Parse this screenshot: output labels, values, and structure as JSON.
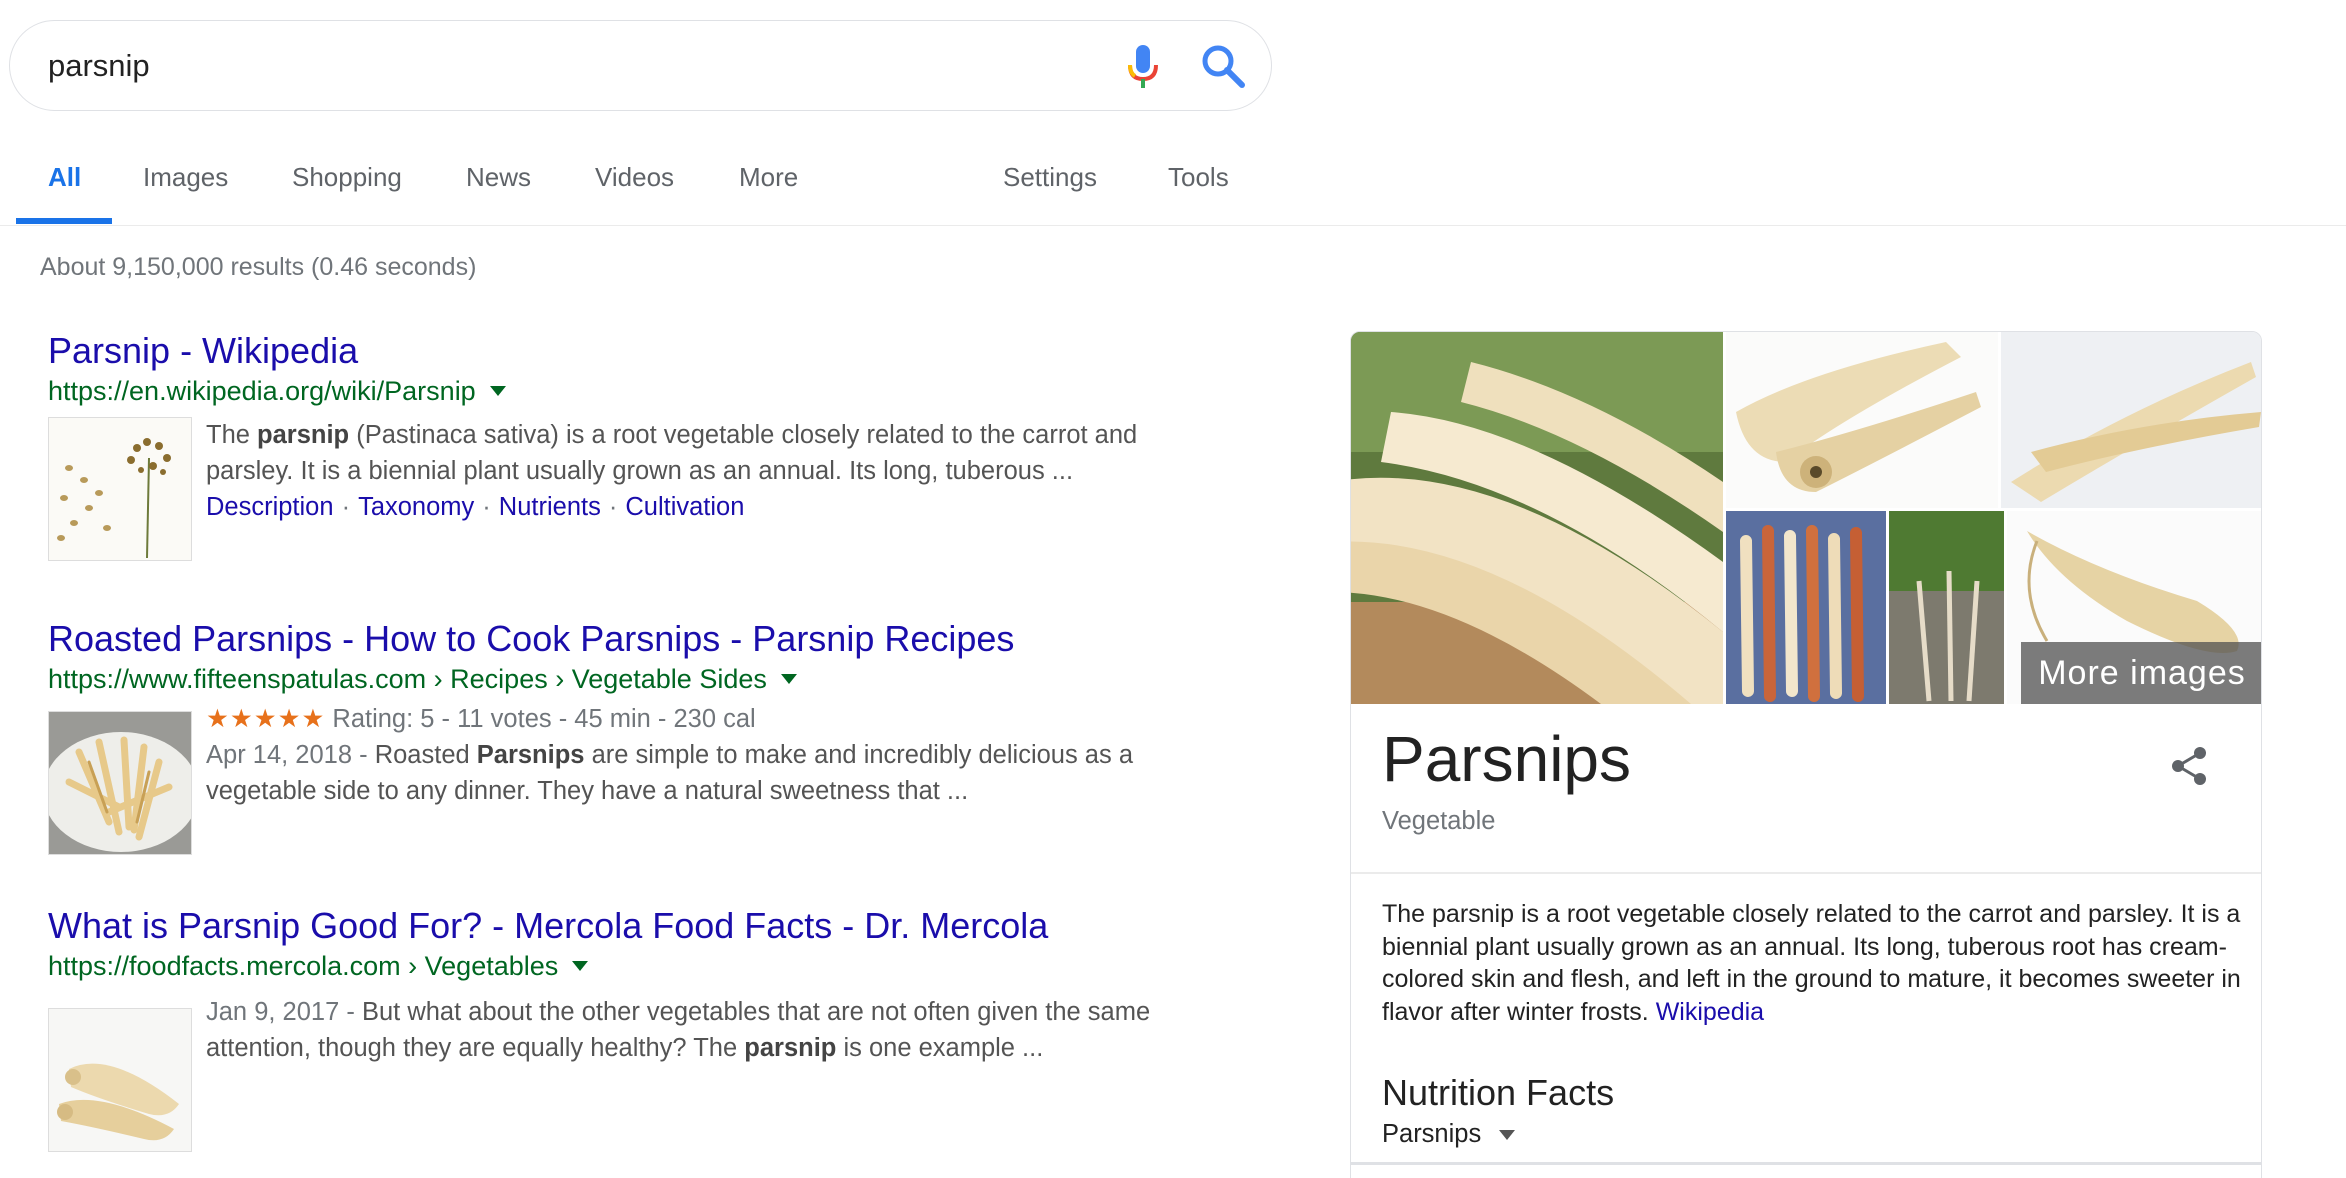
{
  "search": {
    "query": "parsnip"
  },
  "tabs": [
    {
      "label": "All"
    },
    {
      "label": "Images"
    },
    {
      "label": "Shopping"
    },
    {
      "label": "News"
    },
    {
      "label": "Videos"
    },
    {
      "label": "More"
    },
    {
      "label": "Settings"
    },
    {
      "label": "Tools"
    }
  ],
  "result_stats": "About 9,150,000 results (0.46 seconds)",
  "results": [
    {
      "title": "Parsnip - Wikipedia",
      "url": "https://en.wikipedia.org/wiki/Parsnip",
      "snippet_pre": "The ",
      "snippet_bold": "parsnip",
      "snippet_post": " (Pastinaca sativa) is a root vegetable closely related to the carrot and parsley. It is a biennial plant usually grown as an annual. Its long, tuberous ...",
      "sitelinks": [
        "Description",
        "Taxonomy",
        "Nutrients",
        "Cultivation"
      ]
    },
    {
      "title": "Roasted Parsnips - How to Cook Parsnips - Parsnip Recipes",
      "url": "https://www.fifteenspatulas.com › Recipes › Vegetable Sides",
      "stars": "★★★★★",
      "rating": " Rating: 5 - 11 votes - 45 min - 230 cal",
      "date": "Apr 14, 2018 - ",
      "snippet_pre": "Roasted ",
      "snippet_bold": "Parsnips",
      "snippet_post": " are simple to make and incredibly delicious as a vegetable side to any dinner. They have a natural sweetness that ..."
    },
    {
      "title": "What is Parsnip Good For? - Mercola Food Facts - Dr. Mercola",
      "url": "https://foodfacts.mercola.com › Vegetables",
      "date": "Jan 9, 2017 - ",
      "snippet_pre": "But what about the other vegetables that are not often given the same attention, though they are equally healthy? The ",
      "snippet_bold": "parsnip",
      "snippet_post": " is one example ..."
    }
  ],
  "knowledge_panel": {
    "more_images": "More images",
    "title": "Parsnips",
    "subtitle": "Vegetable",
    "description": "The parsnip is a root vegetable closely related to the carrot and parsley. It is a biennial plant usually grown as an annual. Its long, tuberous root has cream-colored skin and flesh, and left in the ground to mature, it becomes sweeter in flavor after winter frosts.",
    "description_source": "Wikipedia",
    "nutrition_title": "Nutrition Facts",
    "nutrition_select": "Parsnips"
  },
  "colors": {
    "link": "#1a0dab",
    "url_green": "#006621",
    "accent_blue": "#1a73e8",
    "star_orange": "#e7711b"
  },
  "icons": [
    "mic-icon",
    "search-icon",
    "share-icon",
    "caret-down-icon"
  ]
}
